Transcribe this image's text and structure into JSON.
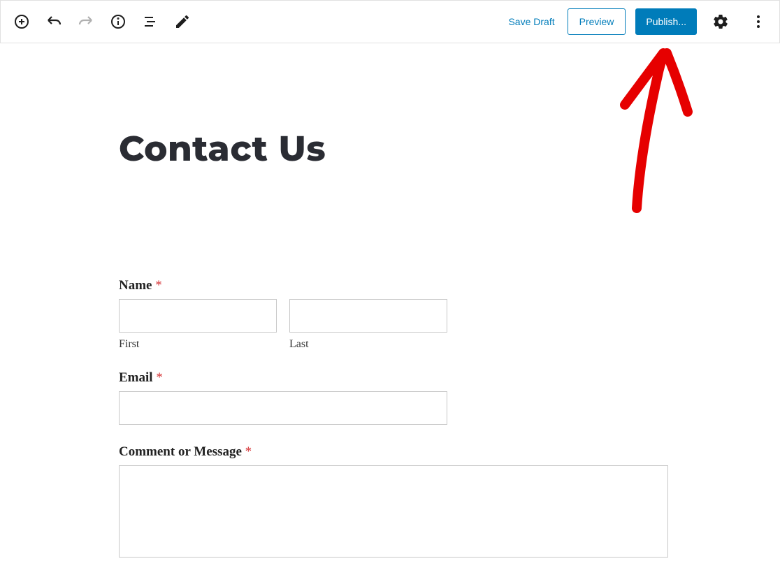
{
  "toolbar": {
    "save_draft": "Save Draft",
    "preview": "Preview",
    "publish": "Publish..."
  },
  "page": {
    "title": "Contact Us"
  },
  "form": {
    "name": {
      "label": "Name",
      "first_sub": "First",
      "last_sub": "Last"
    },
    "email": {
      "label": "Email"
    },
    "message": {
      "label": "Comment or Message"
    },
    "required_marker": "*"
  }
}
